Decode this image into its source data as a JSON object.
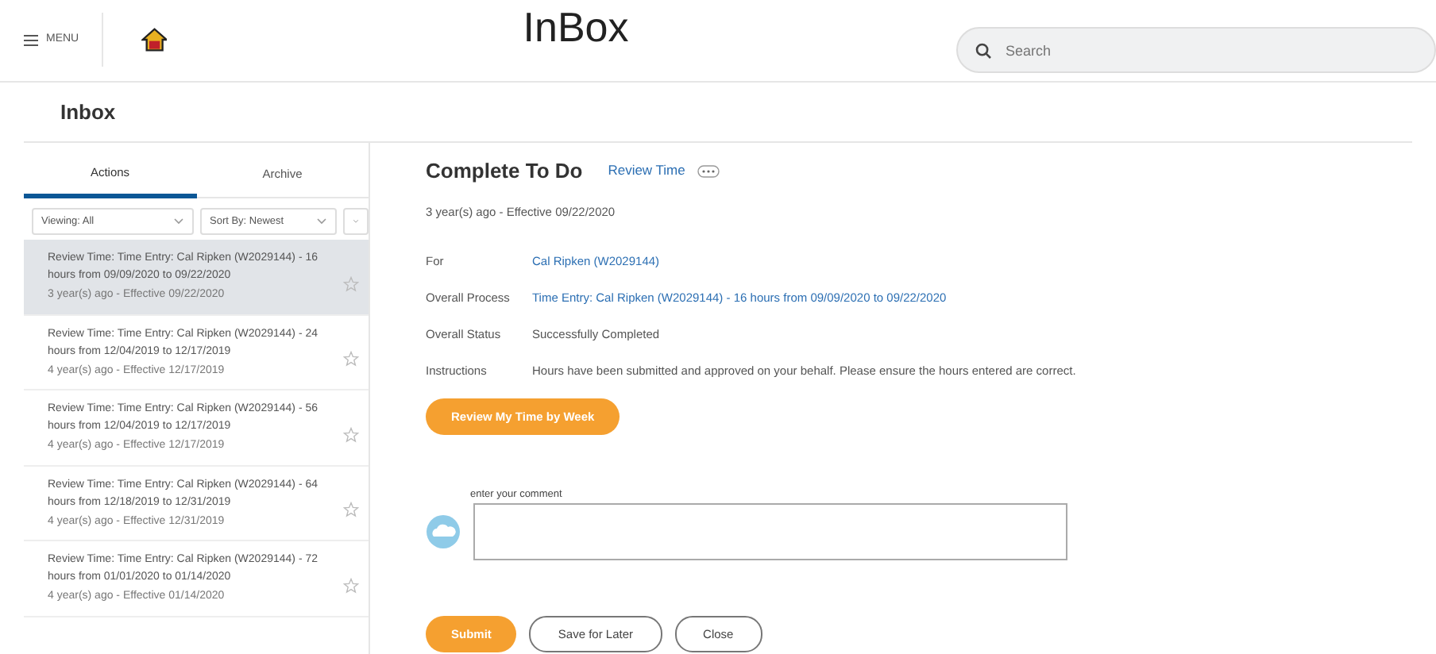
{
  "header": {
    "menu_label": "MENU",
    "title": "InBox",
    "search": {
      "placeholder": "Search"
    }
  },
  "page_title": "Inbox",
  "tabs": [
    {
      "label": "Actions",
      "selected": true
    },
    {
      "label": "Archive",
      "selected": false
    }
  ],
  "filters": [
    {
      "label": "Viewing: All"
    },
    {
      "label": "Sort By: Newest"
    }
  ],
  "inbox_items": [
    {
      "title": "Review Time: Time Entry: Cal Ripken (W2029144) - 16 hours from 09/09/2020 to 09/22/2020",
      "meta": "3 year(s) ago - Effective 09/22/2020",
      "selected": true
    },
    {
      "title": "Review Time: Time Entry: Cal Ripken (W2029144) - 24 hours from 12/04/2019 to 12/17/2019",
      "meta": "4 year(s) ago - Effective 12/17/2019",
      "selected": false
    },
    {
      "title": "Review Time: Time Entry: Cal Ripken (W2029144) - 56 hours from 12/04/2019 to 12/17/2019",
      "meta": "4 year(s) ago - Effective 12/17/2019",
      "selected": false
    },
    {
      "title": "Review Time: Time Entry: Cal Ripken (W2029144) - 64 hours from 12/18/2019 to 12/31/2019",
      "meta": "4 year(s) ago - Effective 12/31/2019",
      "selected": false
    },
    {
      "title": "Review Time: Time Entry: Cal Ripken (W2029144) - 72 hours from 01/01/2020 to 01/14/2020",
      "meta": "4 year(s) ago - Effective 01/14/2020",
      "selected": false
    }
  ],
  "detail": {
    "heading": "Complete To Do",
    "subtitle_link": "Review Time",
    "meta": "3 year(s) ago - Effective 09/22/2020",
    "fields": [
      {
        "label": "For",
        "value": "Cal Ripken (W2029144)",
        "kind": "link"
      },
      {
        "label": "Overall Process",
        "value": "Time Entry: Cal Ripken (W2029144) - 16 hours from 09/09/2020 to 09/22/2020",
        "kind": "link"
      },
      {
        "label": "Overall Status",
        "value": "Successfully Completed",
        "kind": "text"
      },
      {
        "label": "Instructions",
        "value": "Hours have been submitted and approved on your behalf. Please ensure the hours entered are correct.",
        "kind": "text"
      }
    ],
    "action_button": "Review My Time by Week",
    "comment": {
      "label": "enter your comment"
    },
    "buttons": [
      {
        "label": "Submit",
        "kind": "primary"
      },
      {
        "label": "Save for Later",
        "kind": "secondary"
      },
      {
        "label": "Close",
        "kind": "secondary"
      }
    ]
  }
}
